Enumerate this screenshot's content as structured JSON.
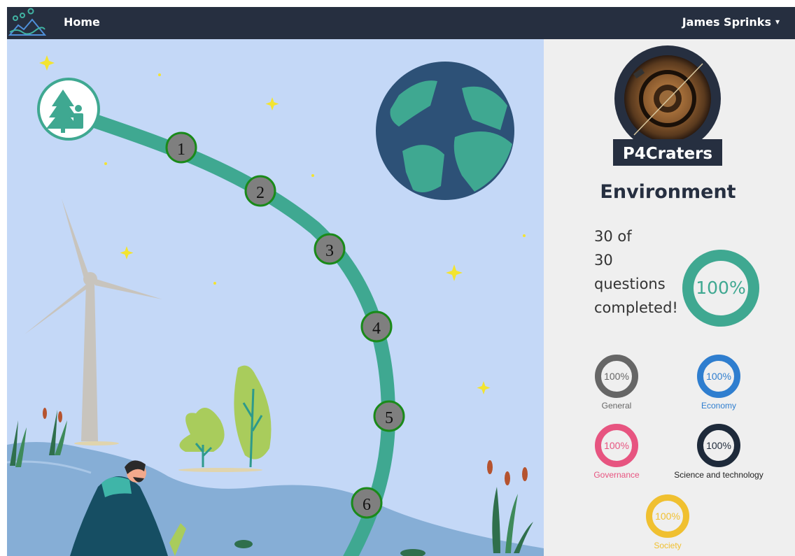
{
  "nav": {
    "home_label": "Home",
    "user_name": "James Sprinks",
    "caret": "▾"
  },
  "map": {
    "stops": [
      "1",
      "2",
      "3",
      "4",
      "5",
      "6"
    ]
  },
  "badge": {
    "label": "P4Craters"
  },
  "topic": {
    "title": "Environment",
    "progress_lines": [
      "30 of",
      "30",
      "questions",
      "completed!"
    ],
    "overall_percent": "100%",
    "overall_value": 1.0
  },
  "categories": [
    {
      "name": "General",
      "percent": "100%",
      "value": 1.0,
      "color": "#666666"
    },
    {
      "name": "Economy",
      "percent": "100%",
      "value": 1.0,
      "color": "#2f7ecf"
    },
    {
      "name": "Governance",
      "percent": "100%",
      "value": 1.0,
      "color": "#e75480"
    },
    {
      "name": "Science and technology",
      "percent": "100%",
      "value": 1.0,
      "color": "#1e2a3a"
    },
    {
      "name": "Society",
      "percent": "100%",
      "value": 1.0,
      "color": "#f0c030"
    }
  ],
  "colors": {
    "navbar": "#262f40",
    "accent": "#3fa891",
    "sky": "#c4d8f7",
    "sidebar": "#efefef"
  }
}
